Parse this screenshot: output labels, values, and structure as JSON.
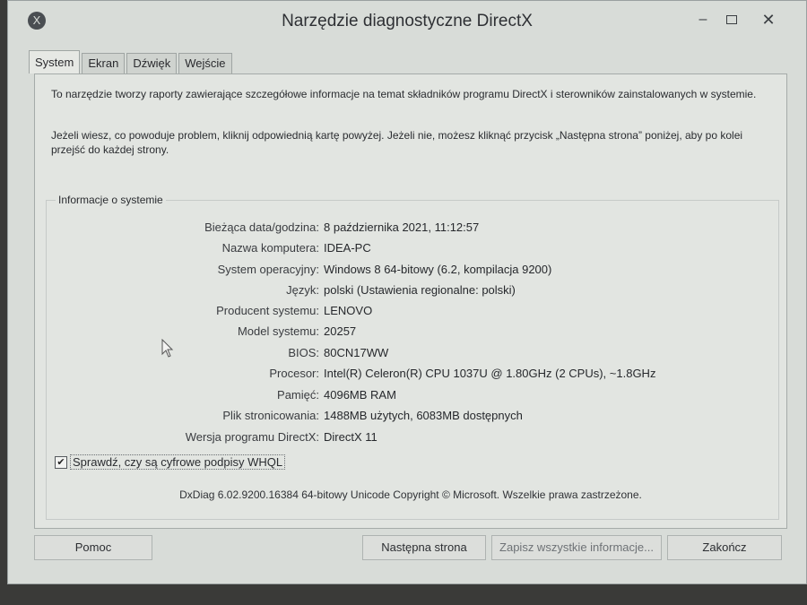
{
  "window": {
    "title": "Narzędzie diagnostyczne DirectX",
    "app_icon": "X",
    "controls": {
      "minimize": "–",
      "close": "✕"
    }
  },
  "tabs": [
    {
      "label": "System",
      "active": true
    },
    {
      "label": "Ekran",
      "active": false
    },
    {
      "label": "Dźwięk",
      "active": false
    },
    {
      "label": "Wejście",
      "active": false
    }
  ],
  "intro": {
    "paragraph1": "To narzędzie tworzy raporty zawierające szczegółowe informacje na temat składników programu DirectX i sterowników zainstalowanych w systemie.",
    "paragraph2": "Jeżeli wiesz, co powoduje problem, kliknij odpowiednią kartę powyżej. Jeżeli nie, możesz kliknąć przycisk „Następna strona” poniżej, aby po kolei przejść do każdej strony."
  },
  "system_info": {
    "group_label": "Informacje o systemie",
    "rows": [
      {
        "label": "Bieżąca data/godzina:",
        "value": "8 października 2021, 11:12:57"
      },
      {
        "label": "Nazwa komputera:",
        "value": "IDEA-PC"
      },
      {
        "label": "System operacyjny:",
        "value": "Windows 8 64-bitowy (6.2, kompilacja 9200)"
      },
      {
        "label": "Język:",
        "value": "polski (Ustawienia regionalne: polski)"
      },
      {
        "label": "Producent systemu:",
        "value": "LENOVO"
      },
      {
        "label": "Model systemu:",
        "value": "20257"
      },
      {
        "label": "BIOS:",
        "value": "80CN17WW"
      },
      {
        "label": "Procesor:",
        "value": "Intel(R) Celeron(R) CPU 1037U @ 1.80GHz (2 CPUs), ~1.8GHz"
      },
      {
        "label": "Pamięć:",
        "value": "4096MB RAM"
      },
      {
        "label": "Plik stronicowania:",
        "value": "1488MB użytych, 6083MB dostępnych"
      },
      {
        "label": "Wersja programu DirectX:",
        "value": "DirectX 11"
      }
    ]
  },
  "whql_check": {
    "label": "Sprawdź, czy są cyfrowe podpisy WHQL",
    "checked": true,
    "mark": "✔"
  },
  "footer": "DxDiag 6.02.9200.16384 64-bitowy Unicode  Copyright © Microsoft. Wszelkie prawa zastrzeżone.",
  "buttons": {
    "help": "Pomoc",
    "next": "Następna strona",
    "save": "Zapisz wszystkie informacje...",
    "exit": "Zakończ"
  }
}
